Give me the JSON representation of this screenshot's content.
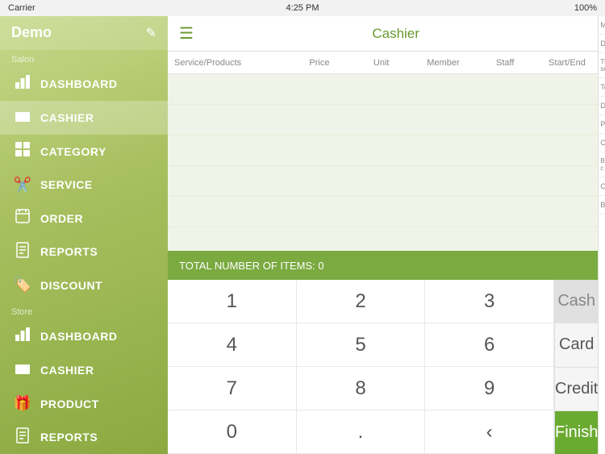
{
  "statusBar": {
    "carrier": "Carrier",
    "time": "4:25 PM",
    "battery": "100%"
  },
  "sidebar": {
    "appTitle": "Demo",
    "salonLabel": "Salon",
    "storeLabel": "Store",
    "items": [
      {
        "id": "dashboard-salon",
        "label": "DASHBOARD",
        "icon": "📊"
      },
      {
        "id": "cashier-salon",
        "label": "CASHIER",
        "icon": "🛒",
        "active": true
      },
      {
        "id": "category",
        "label": "CATEGORY",
        "icon": "📋"
      },
      {
        "id": "service",
        "label": "SERVICE",
        "icon": "✂️"
      },
      {
        "id": "order",
        "label": "ORDER",
        "icon": "📅"
      },
      {
        "id": "reports-salon",
        "label": "REPORTS",
        "icon": "📄"
      },
      {
        "id": "discount",
        "label": "DISCOUNT",
        "icon": "🏷️"
      },
      {
        "id": "dashboard-store",
        "label": "DASHBOARD",
        "icon": "📊"
      },
      {
        "id": "cashier-store",
        "label": "CASHIER",
        "icon": "🛒"
      },
      {
        "id": "product",
        "label": "PRODUCT",
        "icon": "🎁"
      },
      {
        "id": "reports-store",
        "label": "REPORTS",
        "icon": "📄"
      }
    ]
  },
  "topBar": {
    "menuIcon": "≡",
    "title": "Cashier"
  },
  "table": {
    "columns": [
      "Service/Products",
      "Price",
      "Unit",
      "Member",
      "Staff",
      "Start/End"
    ],
    "rows": []
  },
  "totalBar": {
    "label": "TOTAL NUMBER OF ITEMS:",
    "count": "0"
  },
  "keypad": {
    "keys": [
      "1",
      "2",
      "3",
      "4",
      "5",
      "6",
      "7",
      "8",
      "9",
      "0",
      ".",
      "‹"
    ]
  },
  "paymentButtons": [
    {
      "id": "cash",
      "label": "Cash",
      "style": "active"
    },
    {
      "id": "card",
      "label": "Card",
      "style": "normal"
    },
    {
      "id": "credit",
      "label": "Credit",
      "style": "normal"
    },
    {
      "id": "finish",
      "label": "Finish",
      "style": "finish"
    }
  ],
  "rightPanel": {
    "items": [
      "Mem",
      "Disc",
      "The serv",
      "Tot",
      "Disc",
      "Pay",
      "Ca",
      "By c",
      "Cre",
      "Bala"
    ]
  }
}
